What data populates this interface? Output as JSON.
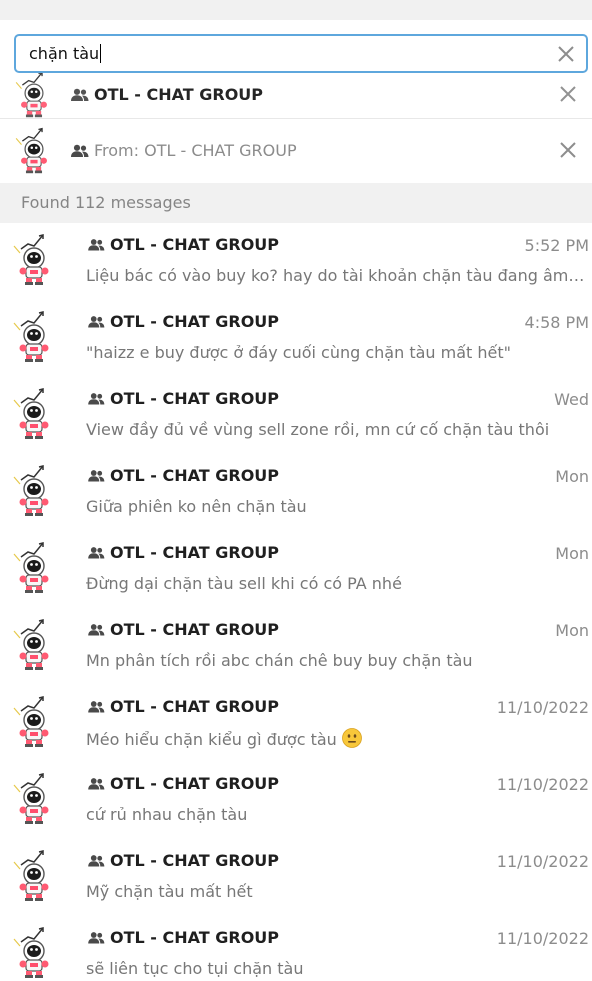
{
  "search": {
    "query": "chặn tàu",
    "clear_icon": "close-icon"
  },
  "filter_chips": [
    {
      "prefix": "",
      "name": "OTL - CHAT GROUP",
      "icon": "group-icon"
    },
    {
      "prefix": "From: ",
      "name": "OTL - CHAT GROUP",
      "icon": "group-icon"
    }
  ],
  "results_header": "Found 112 messages",
  "results": [
    {
      "chat": "OTL - CHAT GROUP",
      "time": "5:52 PM",
      "text": "Liệu bác có vào buy ko? hay do tài khoản chặn tàu đang âm do sell",
      "emoji": ""
    },
    {
      "chat": "OTL - CHAT GROUP",
      "time": "4:58 PM",
      "text": "\"haizz e buy được ở đáy cuối cùng chặn tàu mất hết\"",
      "emoji": ""
    },
    {
      "chat": "OTL - CHAT GROUP",
      "time": "Wed",
      "text": "View đầy đủ về vùng sell zone rồi, mn cứ cố chặn tàu thôi",
      "emoji": ""
    },
    {
      "chat": "OTL - CHAT GROUP",
      "time": "Mon",
      "text": "Giữa phiên ko nên chặn tàu",
      "emoji": ""
    },
    {
      "chat": "OTL - CHAT GROUP",
      "time": "Mon",
      "text": "Đừng dại chặn tàu sell khi có có PA nhé",
      "emoji": ""
    },
    {
      "chat": "OTL - CHAT GROUP",
      "time": "Mon",
      "text": "Mn phân tích rồi abc chán chê buy buy chặn tàu",
      "emoji": ""
    },
    {
      "chat": "OTL - CHAT GROUP",
      "time": "11/10/2022",
      "text": "Méo hiểu chặn kiểu gì được tàu",
      "emoji": "neutral-face"
    },
    {
      "chat": "OTL - CHAT GROUP",
      "time": "11/10/2022",
      "text": "cứ rủ nhau chặn tàu",
      "emoji": ""
    },
    {
      "chat": "OTL - CHAT GROUP",
      "time": "11/10/2022",
      "text": "Mỹ chặn tàu mất hết",
      "emoji": ""
    },
    {
      "chat": "OTL - CHAT GROUP",
      "time": "11/10/2022",
      "text": "sẽ liên tục cho tụi chặn tàu",
      "emoji": ""
    }
  ],
  "colors": {
    "accent": "#5ea7dd",
    "header_bg": "#f1f1f1",
    "muted_text": "#8c8c8c"
  }
}
